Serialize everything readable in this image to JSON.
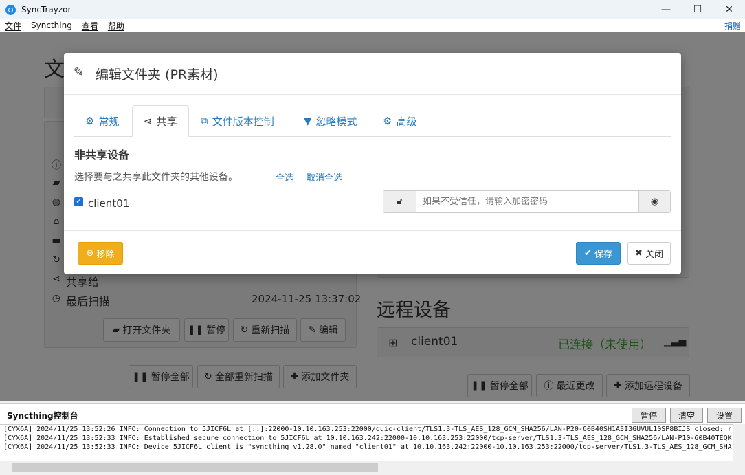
{
  "window": {
    "title": "SyncTrayzor",
    "minimize": "—",
    "maximize": "☐",
    "close": "✕"
  },
  "menu": {
    "items": [
      "文件",
      "Syncthing",
      "查看",
      "帮助"
    ],
    "donate": "捐赠"
  },
  "background": {
    "folders_heading": "文",
    "shared_with_label": "共享给",
    "last_scan_label": "最后扫描",
    "last_scan_value": "2024-11-25 13:37:02",
    "folder_buttons": [
      "打开文件夹",
      "暂停",
      "重新扫描",
      "编辑"
    ],
    "folders_footer_buttons": [
      "暂停全部",
      "全部重新扫描",
      "添加文件夹"
    ],
    "remote_heading": "远程设备",
    "device_name": "client01",
    "device_status": "已连接（未使用）",
    "remote_footer_buttons": [
      "暂停全部",
      "最近更改",
      "添加远程设备"
    ]
  },
  "modal": {
    "title": "编辑文件夹 (PR素材)",
    "tabs": [
      "常规",
      "共享",
      "文件版本控制",
      "忽略模式",
      "高级"
    ],
    "active_tab": "共享",
    "section_title": "非共享设备",
    "hint": "选择要与之共享此文件夹的其他设备。",
    "select_all": "全选",
    "deselect_all": "取消全选",
    "device_label": "client01",
    "device_checked": true,
    "password_placeholder": "如果不受信任，请输入加密密码",
    "remove_label": "移除",
    "save_label": "保存",
    "close_label": "关闭"
  },
  "console": {
    "title": "Syncthing控制台",
    "buttons": [
      "暂停",
      "清空",
      "设置"
    ],
    "lines": [
      "[CYX6A] 2024/11/25 13:52:26 INFO: Connection to 5JICF6L at [::]:22000-10.10.163.253:22000/quic-client/TLS1.3-TLS_AES_128_GCM_SHA256/LAN-P20-60B40SH1A3I3GUVUL10SP8BIJS closed: r",
      "[CYX6A] 2024/11/25 13:52:33 INFO: Established secure connection to 5JICF6L at 10.10.163.242:22000-10.10.163.253:22000/tcp-server/TLS1.3-TLS_AES_128_GCM_SHA256/LAN-P10-60B40TEQK",
      "[CYX6A] 2024/11/25 13:52:33 INFO: Device 5JICF6L client is \"syncthing v1.28.0\" named \"client01\" at 10.10.163.242:22000-10.10.163.253:22000/tcp-server/TLS1.3-TLS_AES_128_GCM_SHA"
    ]
  },
  "colors": {
    "accent": "#2a7ab8",
    "warning": "#f0ad1e",
    "primary": "#3b97d3",
    "success": "#3fa535"
  }
}
